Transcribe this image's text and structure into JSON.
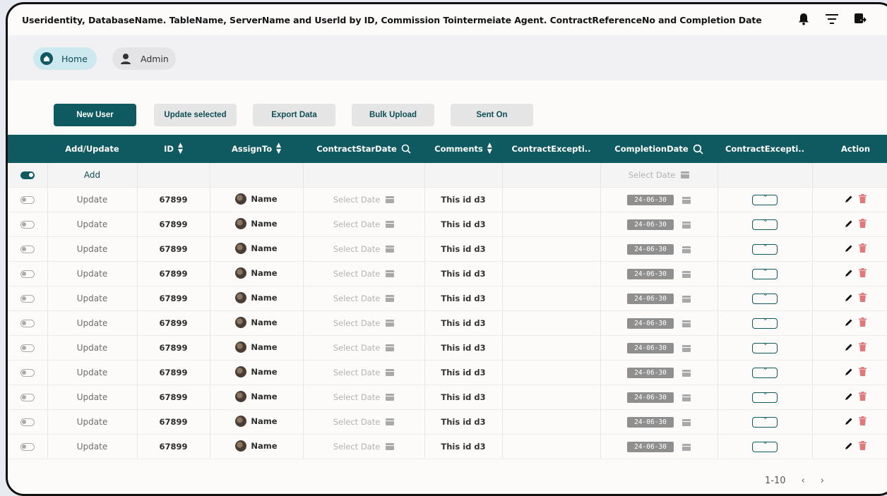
{
  "app": {
    "title": "Useridentity, DatabaseName. TableName, ServerName and Userld by ID, Commission Tointermeiate Agent. ContractReferenceNo and Completion Date"
  },
  "nav": {
    "home": "Home",
    "admin": "Admin"
  },
  "toolbar": {
    "new_user": "New User",
    "update_selected": "Update selected",
    "export_data": "Export Data",
    "bulk_upload": "Bulk Upload",
    "sent_on": "Sent On"
  },
  "table": {
    "headers": {
      "add_update": "Add/Update",
      "id": "ID",
      "assign_to": "AssignTo",
      "contract_start": "ContractStarDate",
      "comments": "Comments",
      "contract_exception_1": "ContractExcepti..",
      "completion_date": "CompletionDate",
      "contract_exception_2": "ContractExcepti..",
      "action": "Action"
    },
    "add_row": {
      "label": "Add",
      "completion_placeholder": "Select Date"
    },
    "rows": [
      {
        "action": "Update",
        "id": "67899",
        "assign": "Name",
        "start": "Select Date",
        "comment": "This id d3",
        "completion": "24-06-30"
      },
      {
        "action": "Update",
        "id": "67899",
        "assign": "Name",
        "start": "Select Date",
        "comment": "This id d3",
        "completion": "24-06-30"
      },
      {
        "action": "Update",
        "id": "67899",
        "assign": "Name",
        "start": "Select Date",
        "comment": "This id d3",
        "completion": "24-06-30"
      },
      {
        "action": "Update",
        "id": "67899",
        "assign": "Name",
        "start": "Select Date",
        "comment": "This id d3",
        "completion": "24-06-30"
      },
      {
        "action": "Update",
        "id": "67899",
        "assign": "Name",
        "start": "Select Date",
        "comment": "This id d3",
        "completion": "24-06-30"
      },
      {
        "action": "Update",
        "id": "67899",
        "assign": "Name",
        "start": "Select Date",
        "comment": "This id d3",
        "completion": "24-06-30"
      },
      {
        "action": "Update",
        "id": "67899",
        "assign": "Name",
        "start": "Select Date",
        "comment": "This id d3",
        "completion": "24-06-30"
      },
      {
        "action": "Update",
        "id": "67899",
        "assign": "Name",
        "start": "Select Date",
        "comment": "This id d3",
        "completion": "24-06-30"
      },
      {
        "action": "Update",
        "id": "67899",
        "assign": "Name",
        "start": "Select Date",
        "comment": "This id d3",
        "completion": "24-06-30"
      },
      {
        "action": "Update",
        "id": "67899",
        "assign": "Name",
        "start": "Select Date",
        "comment": "This id d3",
        "completion": "24-06-30"
      },
      {
        "action": "Update",
        "id": "67899",
        "assign": "Name",
        "start": "Select Date",
        "comment": "This id d3",
        "completion": "24-06-30"
      }
    ]
  },
  "pagination": {
    "range": "1-10",
    "prev": "‹",
    "next": "›"
  },
  "colors": {
    "accent": "#0f5a60",
    "delete": "#e07a7a"
  },
  "icons": {
    "top": [
      "bell-icon",
      "filter-icon",
      "export-icon"
    ],
    "nav": [
      "home-icon",
      "user-icon"
    ],
    "table": [
      "sort-icon",
      "search-icon",
      "calendar-icon",
      "chevron-down-icon",
      "pencil-icon",
      "trash-icon"
    ]
  }
}
